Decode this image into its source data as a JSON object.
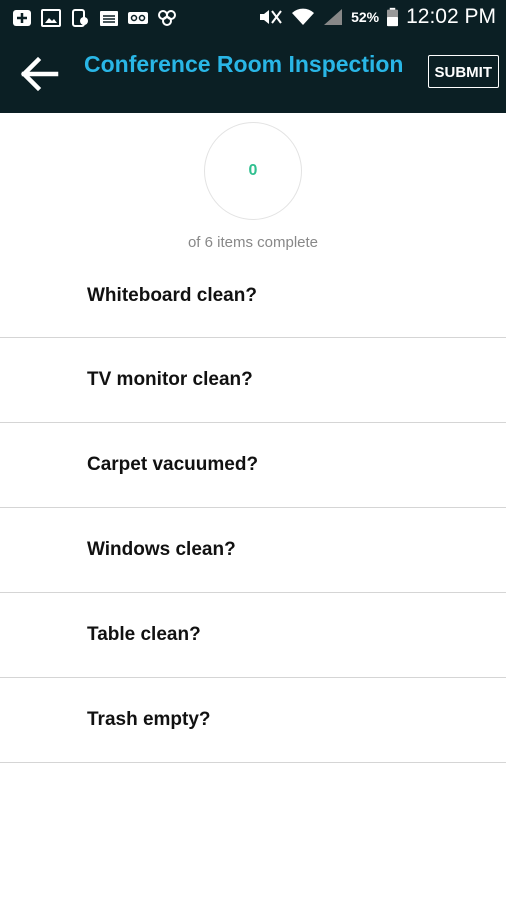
{
  "status_bar": {
    "battery_percent": "52%",
    "time": "12:02 PM",
    "icons": [
      "add-icon",
      "image-icon",
      "phone-icon",
      "calendar-icon",
      "voicemail-icon",
      "rings-icon",
      "mute-icon",
      "wifi-icon",
      "signal-icon",
      "battery-icon"
    ]
  },
  "app_bar": {
    "title": "Conference Room Inspection",
    "submit_label": "SUBMIT",
    "colors": {
      "background": "#0b1f24",
      "title": "#29b6e6"
    }
  },
  "progress": {
    "completed": "0",
    "caption": "of 6 items complete",
    "color": "#2fbf8f"
  },
  "checklist": {
    "items": [
      {
        "label": "Whiteboard clean?"
      },
      {
        "label": "TV monitor clean?"
      },
      {
        "label": "Carpet vacuumed?"
      },
      {
        "label": "Windows clean?"
      },
      {
        "label": "Table clean?"
      },
      {
        "label": "Trash empty?"
      }
    ]
  }
}
